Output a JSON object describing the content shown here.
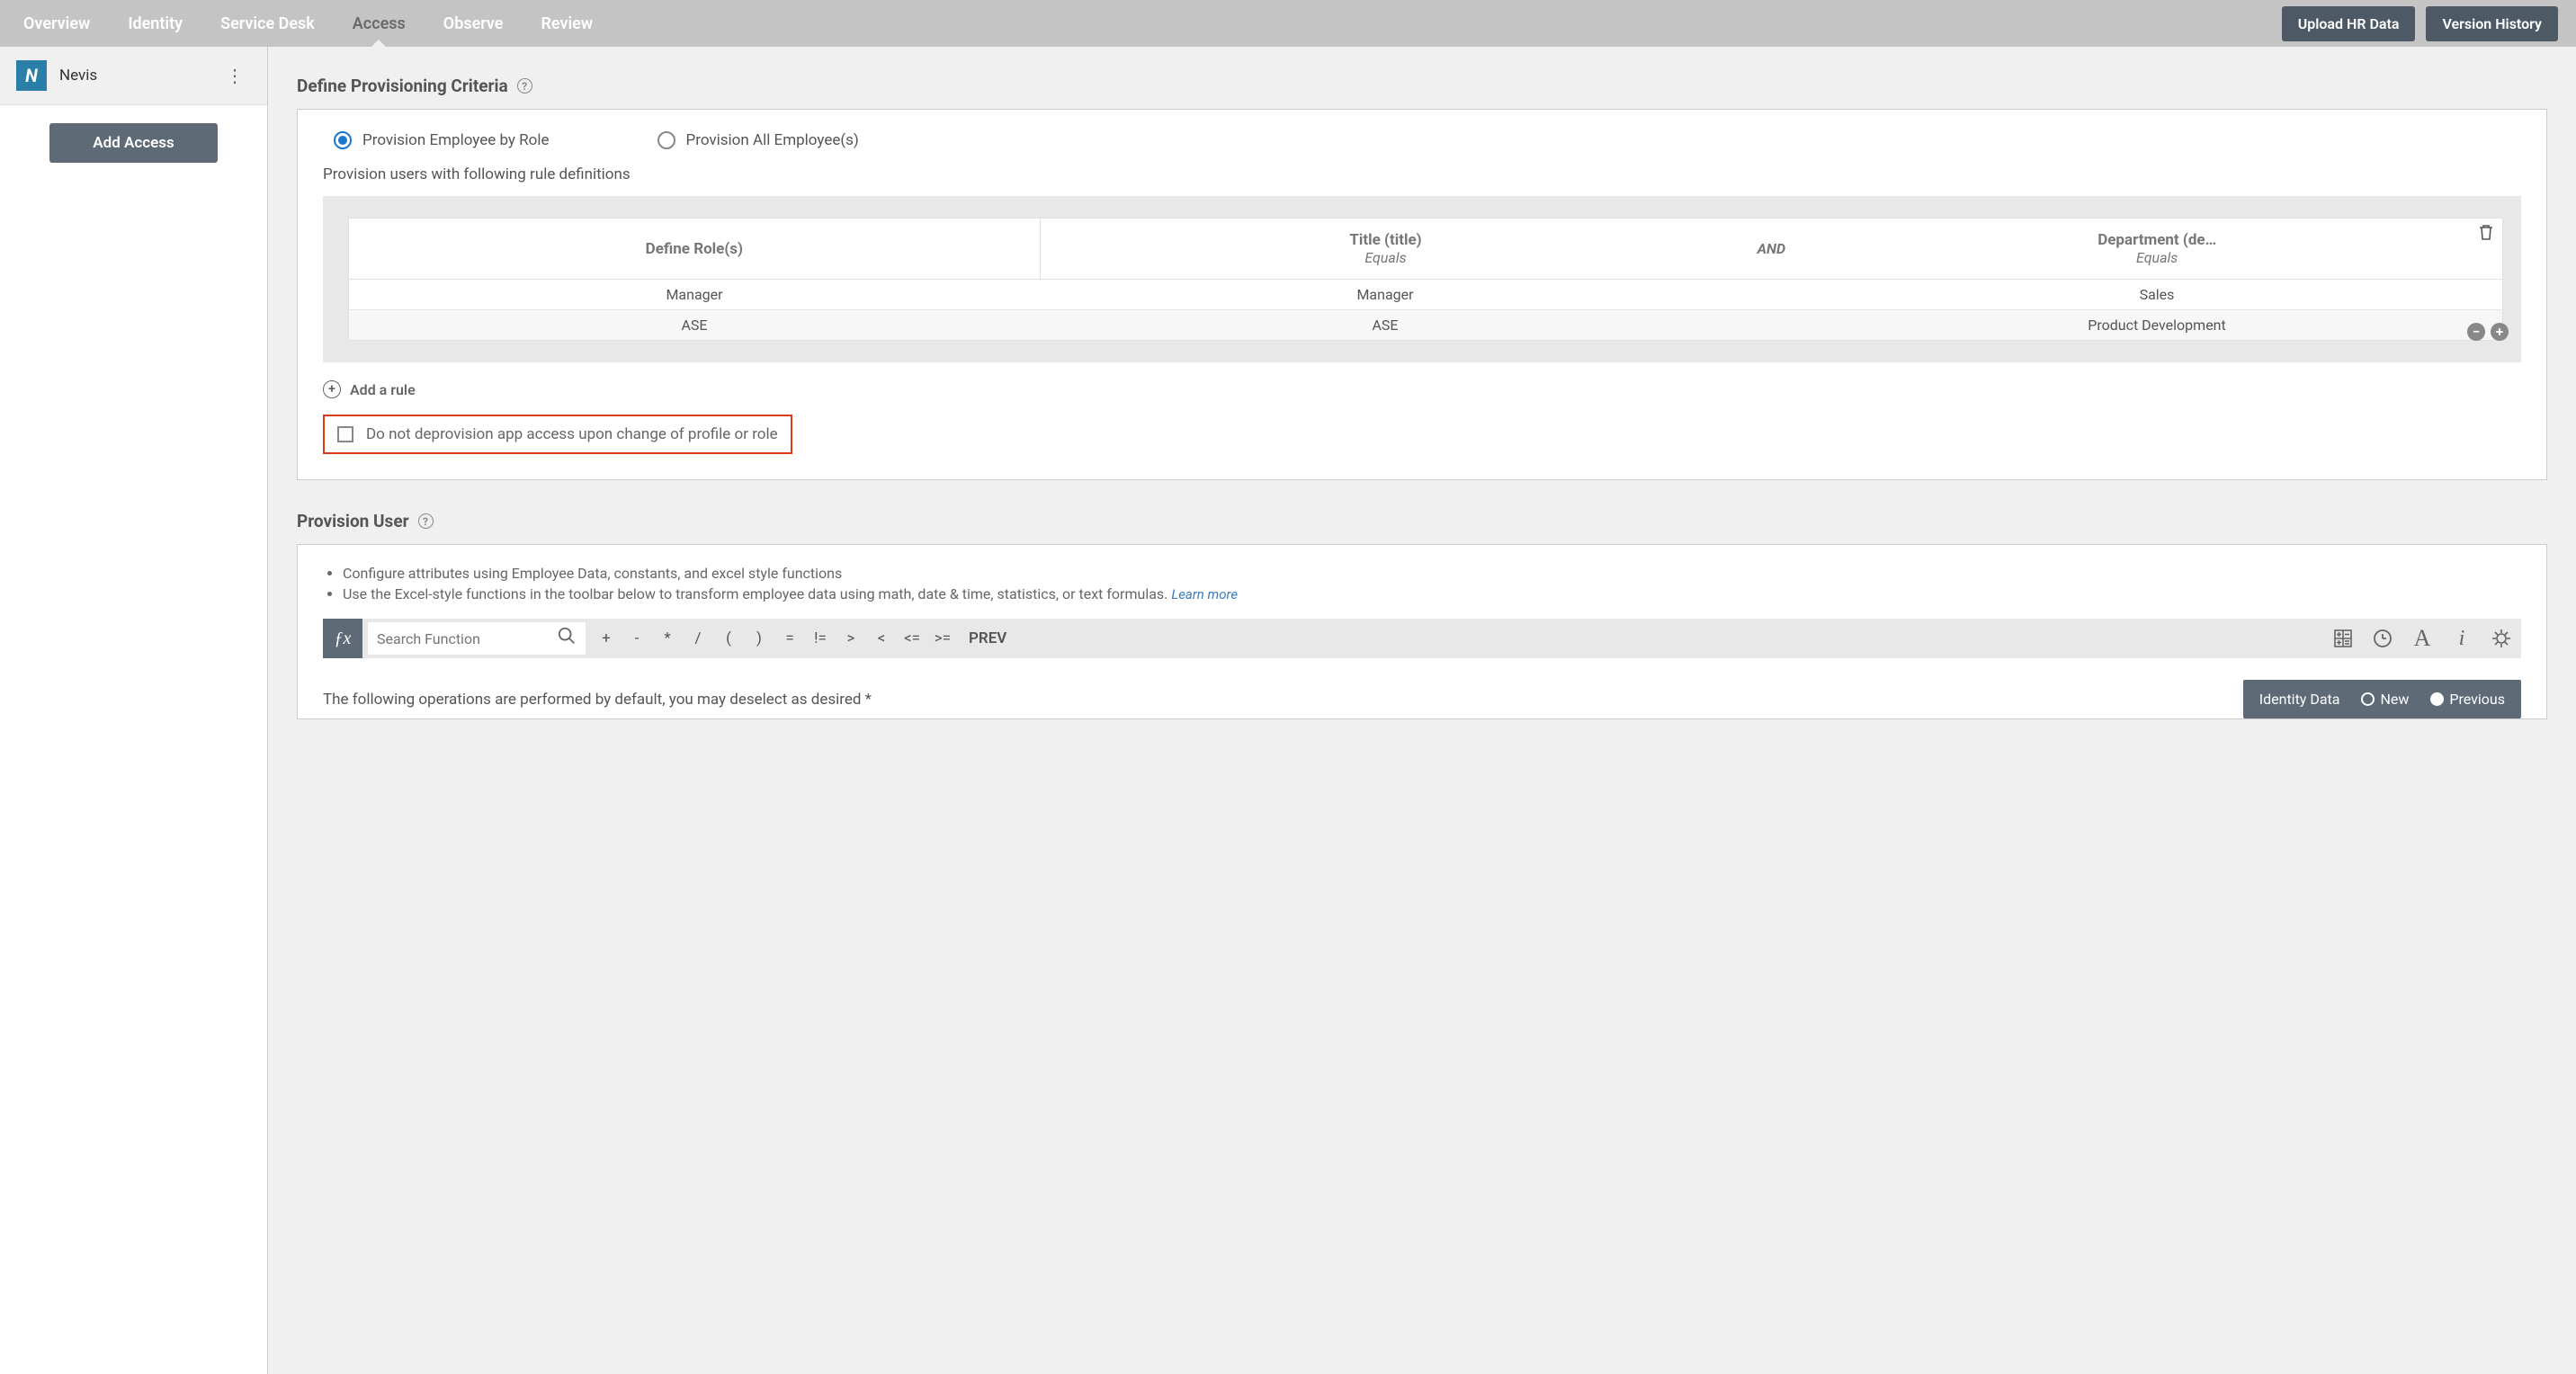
{
  "nav": {
    "tabs": [
      "Overview",
      "Identity",
      "Service Desk",
      "Access",
      "Observe",
      "Review"
    ],
    "active_index": 3,
    "upload_btn": "Upload HR Data",
    "version_btn": "Version History"
  },
  "sidebar": {
    "app_logo_letter": "N",
    "app_name": "Nevis",
    "add_access_btn": "Add Access"
  },
  "criteria": {
    "title": "Define Provisioning Criteria",
    "radio_by_role": "Provision Employee by Role",
    "radio_all": "Provision All Employee(s)",
    "caption": "Provision users with following rule definitions",
    "headers": {
      "col1": "Define Role(s)",
      "col2_top": "Title (title)",
      "col2_sub": "Equals",
      "and": "AND",
      "col3_top": "Department (de…",
      "col3_sub": "Equals"
    },
    "rows": [
      {
        "role": "Manager",
        "title": "Manager",
        "dept": "Sales"
      },
      {
        "role": "ASE",
        "title": "ASE",
        "dept": "Product Development"
      }
    ],
    "add_rule": "Add a rule",
    "deprov_checkbox": "Do not deprovision app access upon change of profile or role"
  },
  "provision": {
    "title": "Provision User",
    "bullet1": "Configure attributes using Employee Data, constants, and excel style functions",
    "bullet2": "Use the Excel-style functions in the toolbar below to transform employee data using math, date & time, statistics, or text formulas.",
    "learn_more": "Learn more",
    "search_placeholder": "Search Function",
    "ops": [
      "+",
      "-",
      "*",
      "/",
      "(",
      ")",
      "=",
      "!=",
      ">",
      "<",
      "<=",
      ">="
    ],
    "prev_btn": "PREV",
    "footer_text": "The following operations are performed by default, you may deselect as desired *",
    "identity_bar": {
      "label": "Identity Data",
      "new": "New",
      "previous": "Previous"
    }
  }
}
